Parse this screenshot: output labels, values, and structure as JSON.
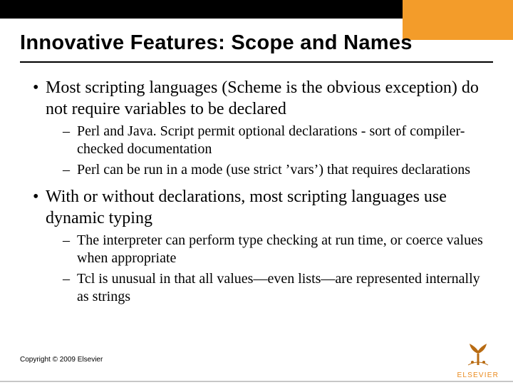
{
  "title": "Innovative Features: Scope and Names",
  "bullets": [
    {
      "text": "Most scripting languages (Scheme is the obvious exception) do not require variables to be declared",
      "sub": [
        "Perl and Java. Script permit optional declarations - sort of compiler-checked documentation",
        "Perl can be run in a mode (use strict ’vars’) that requires declarations"
      ]
    },
    {
      "text": "With or without declarations, most scripting languages use dynamic typing",
      "sub": [
        "The interpreter can perform type checking at run time, or coerce values when appropriate",
        "Tcl is unusual in that all values—even lists—are represented internally as strings"
      ]
    }
  ],
  "copyright": "Copyright © 2009 Elsevier",
  "logo": {
    "text": "ELSEVIER"
  }
}
